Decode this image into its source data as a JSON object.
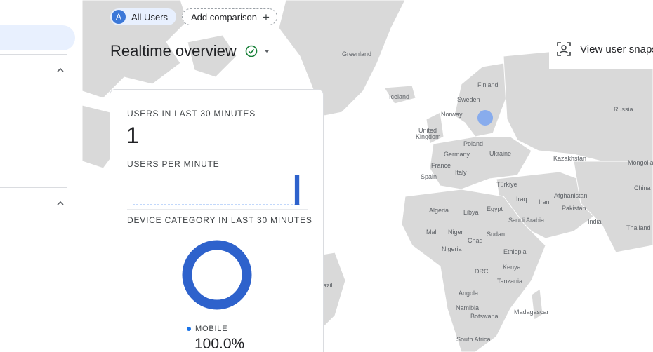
{
  "comparison": {
    "segment_initial": "A",
    "segment_label": "All Users",
    "add_label": "Add comparison"
  },
  "page": {
    "title": "Realtime overview"
  },
  "actions": {
    "view_snapshot_label": "View user snaps"
  },
  "card": {
    "users_30_label": "USERS IN LAST 30 MINUTES",
    "users_30_value": "1",
    "users_per_minute_label": "USERS PER MINUTE",
    "users_per_minute_series": [
      0,
      0,
      0,
      0,
      0,
      0,
      0,
      0,
      0,
      0,
      0,
      0,
      0,
      0,
      0,
      0,
      0,
      0,
      0,
      0,
      0,
      0,
      0,
      0,
      0,
      0,
      0,
      0,
      0,
      1
    ],
    "device_label": "DEVICE CATEGORY IN LAST 30 MINUTES",
    "device_legend": "MOBILE",
    "device_percent": "100.0%",
    "accent": "#2e62cc"
  },
  "map_labels": {
    "greenland": "Greenland",
    "iceland": "Iceland",
    "finland": "Finland",
    "sweden": "Sweden",
    "norway": "Norway",
    "russia": "Russia",
    "united_kingdom_1": "United",
    "united_kingdom_2": "Kingdom",
    "poland": "Poland",
    "germany": "Germany",
    "ukraine": "Ukraine",
    "kazakhstan": "Kazakhstan",
    "france": "France",
    "italy": "Italy",
    "mongolia": "Mongolia",
    "spain": "Spain",
    "turkiye": "Türkiye",
    "china": "China",
    "afghanistan": "Afghanistan",
    "iraq": "Iraq",
    "iran": "Iran",
    "algeria": "Algeria",
    "libya": "Libya",
    "egypt": "Egypt",
    "pakistan": "Pakistan",
    "saudi_arabia": "Saudi Arabia",
    "india": "India",
    "thailand": "Thailand",
    "mali": "Mali",
    "niger": "Niger",
    "sudan": "Sudan",
    "chad": "Chad",
    "nigeria": "Nigeria",
    "ethiopia": "Ethiopia",
    "drc": "DRC",
    "kenya": "Kenya",
    "tanzania": "Tanzania",
    "angola": "Angola",
    "namibia": "Namibia",
    "botswana": "Botswana",
    "madagascar": "Madagascar",
    "south_africa": "South Africa",
    "brazil_fragment": "azil"
  }
}
